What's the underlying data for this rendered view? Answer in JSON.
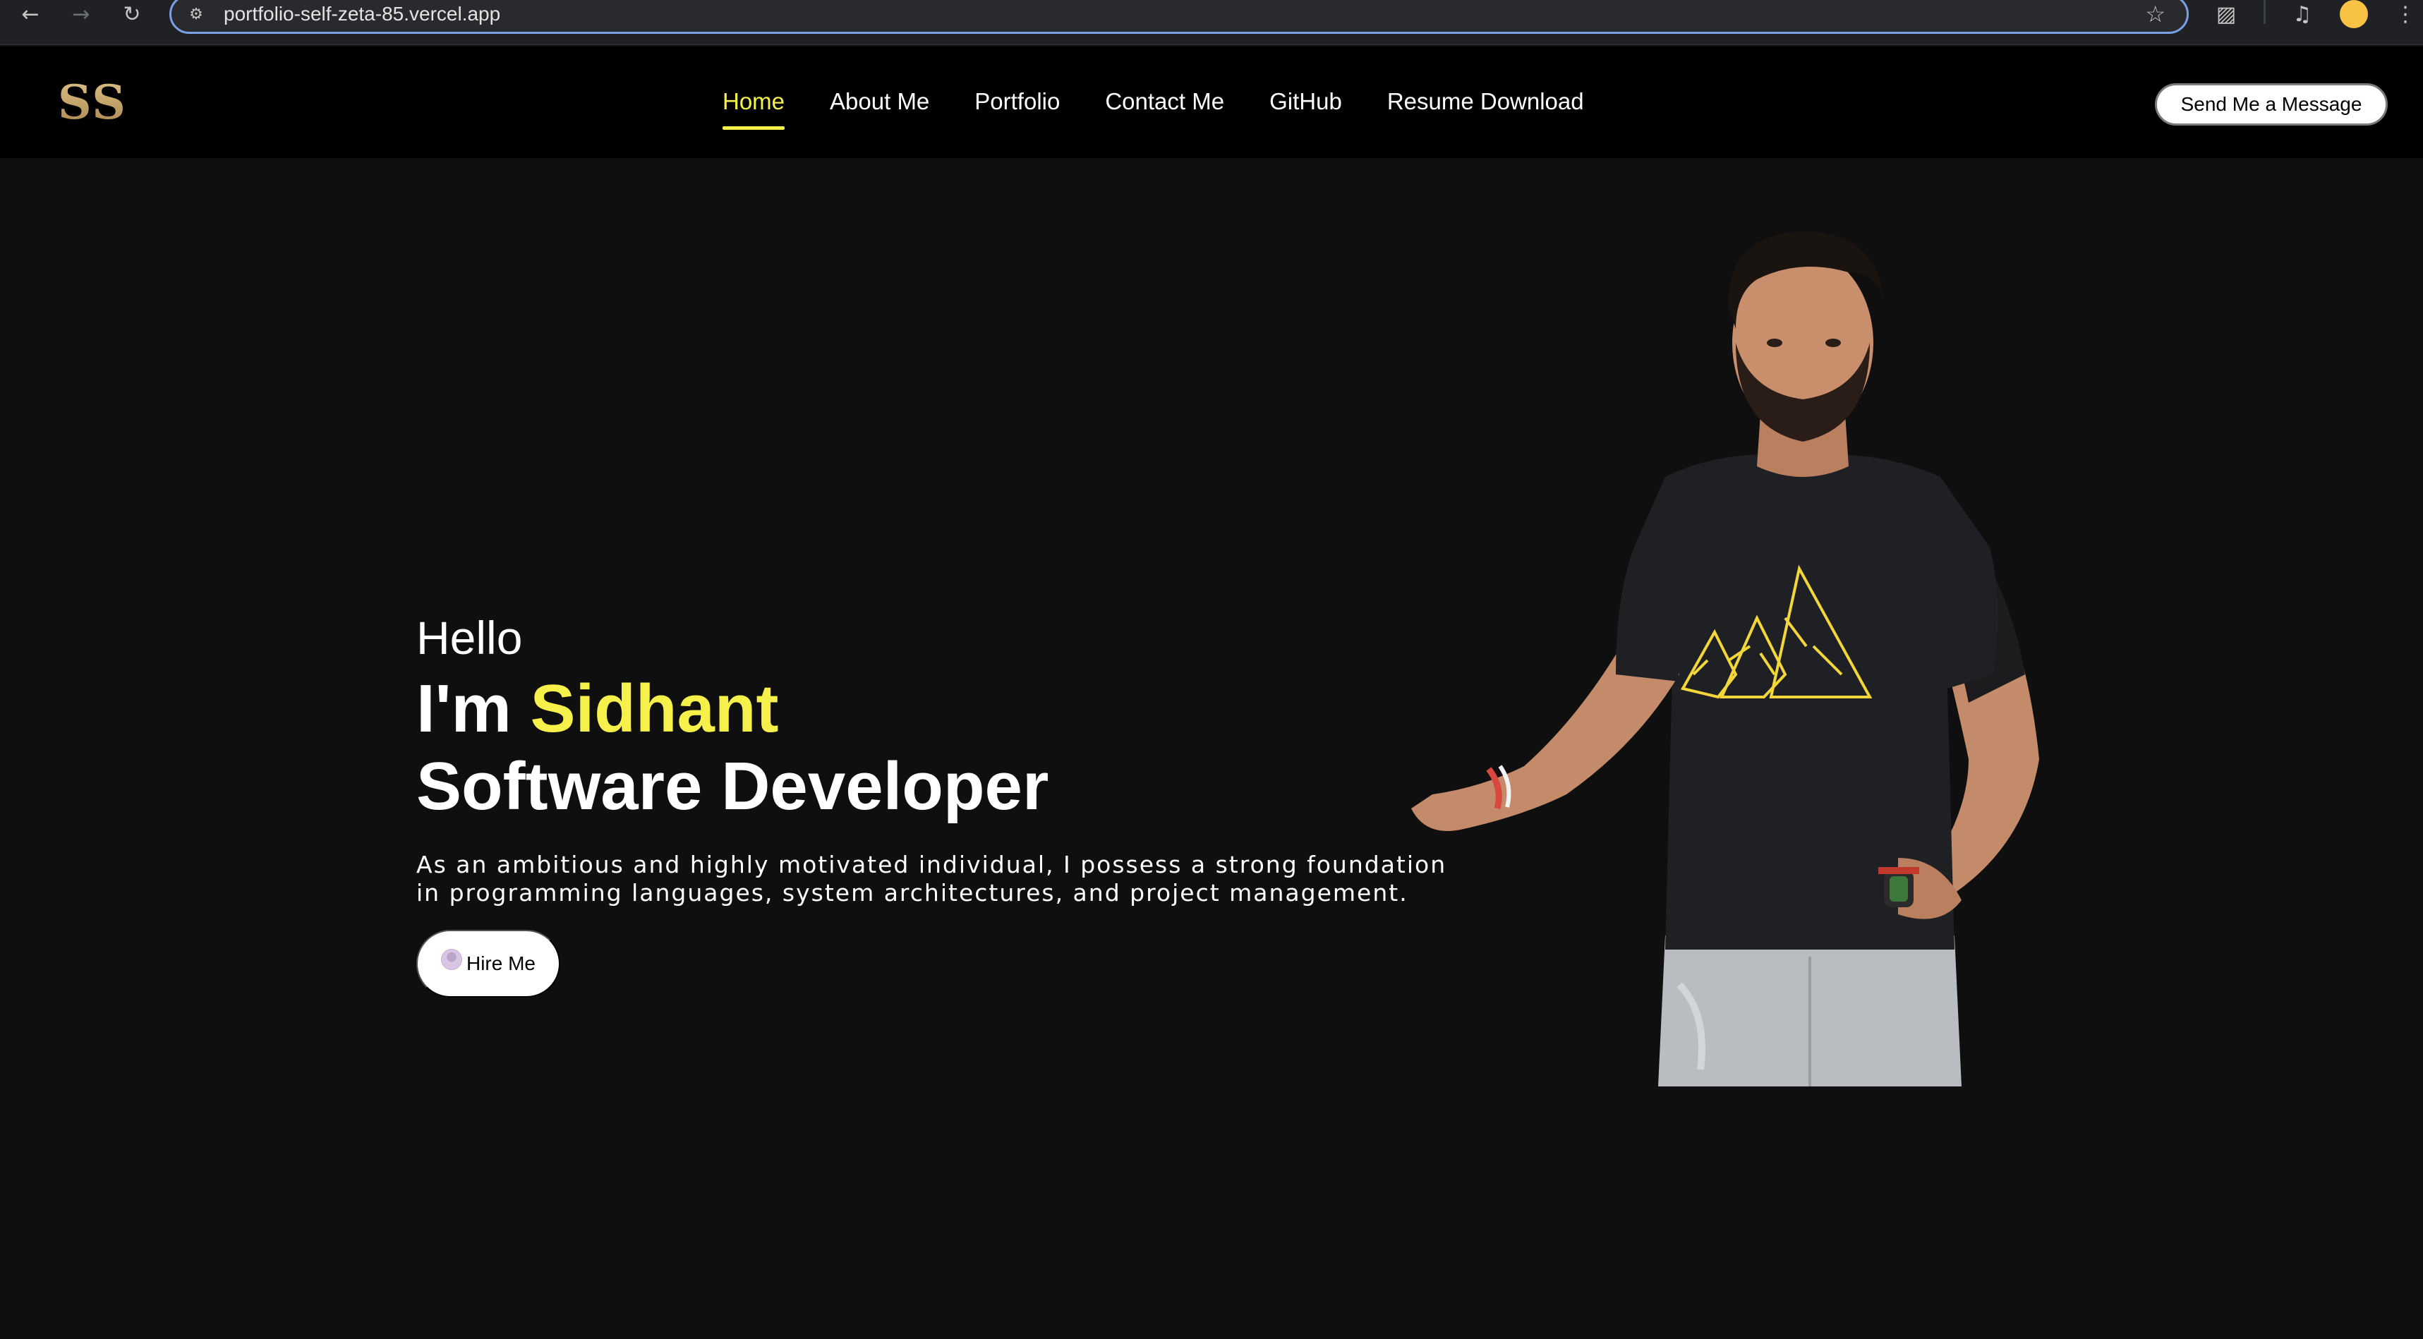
{
  "browser": {
    "url": "portfolio-self-zeta-85.vercel.app"
  },
  "site": {
    "logo": "SS",
    "nav": [
      {
        "label": "Home",
        "active": true
      },
      {
        "label": "About Me",
        "active": false
      },
      {
        "label": "Portfolio",
        "active": false
      },
      {
        "label": "Contact Me",
        "active": false
      },
      {
        "label": "GitHub",
        "active": false
      },
      {
        "label": "Resume Download",
        "active": false
      }
    ],
    "cta_label": "Send Me a Message"
  },
  "hero": {
    "greeting": "Hello",
    "name_prefix": "I'm ",
    "name": "Sidhant",
    "role": "Software Developer",
    "description_line1": "As an ambitious and highly motivated individual, I possess a strong foundation",
    "description_line2": "in programming languages, system architectures, and project management.",
    "hire_label": "Hire Me"
  },
  "colors": {
    "accent": "#f5f04a",
    "background": "#0f0f0f",
    "header": "#000000",
    "logo_gold": "#c8a96a"
  }
}
